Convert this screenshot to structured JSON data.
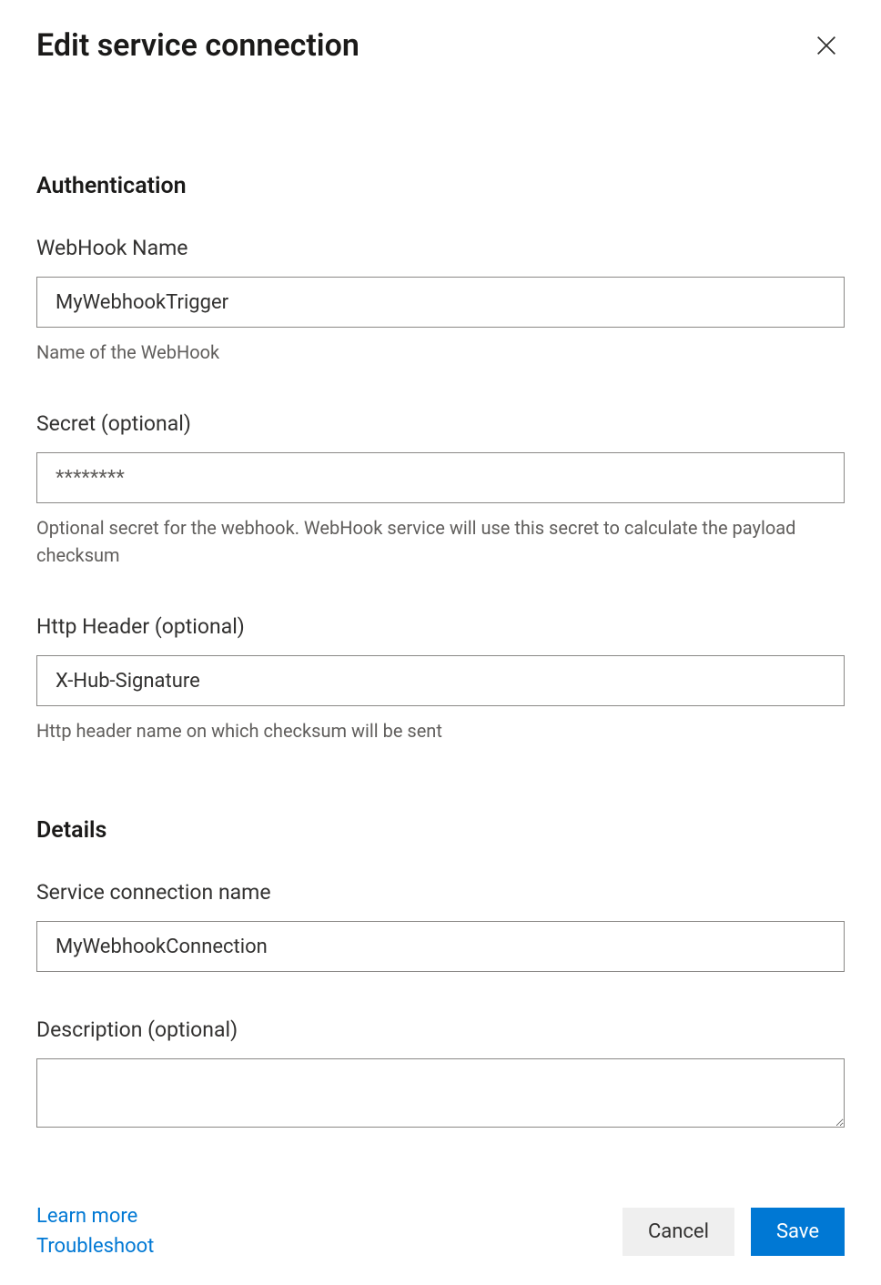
{
  "dialog": {
    "title": "Edit service connection"
  },
  "sections": {
    "authentication": {
      "title": "Authentication",
      "fields": {
        "webhookName": {
          "label": "WebHook Name",
          "value": "MyWebhookTrigger",
          "help": "Name of the WebHook"
        },
        "secret": {
          "label": "Secret (optional)",
          "placeholder": "********",
          "value": "",
          "help": "Optional secret for the webhook. WebHook service will use this secret to calculate the payload checksum"
        },
        "httpHeader": {
          "label": "Http Header (optional)",
          "value": "X-Hub-Signature",
          "help": "Http header name on which checksum will be sent"
        }
      }
    },
    "details": {
      "title": "Details",
      "fields": {
        "name": {
          "label": "Service connection name",
          "value": "MyWebhookConnection"
        },
        "description": {
          "label": "Description (optional)",
          "value": ""
        }
      }
    }
  },
  "footer": {
    "links": {
      "learnMore": "Learn more",
      "troubleshoot": "Troubleshoot"
    },
    "buttons": {
      "cancel": "Cancel",
      "save": "Save"
    }
  }
}
